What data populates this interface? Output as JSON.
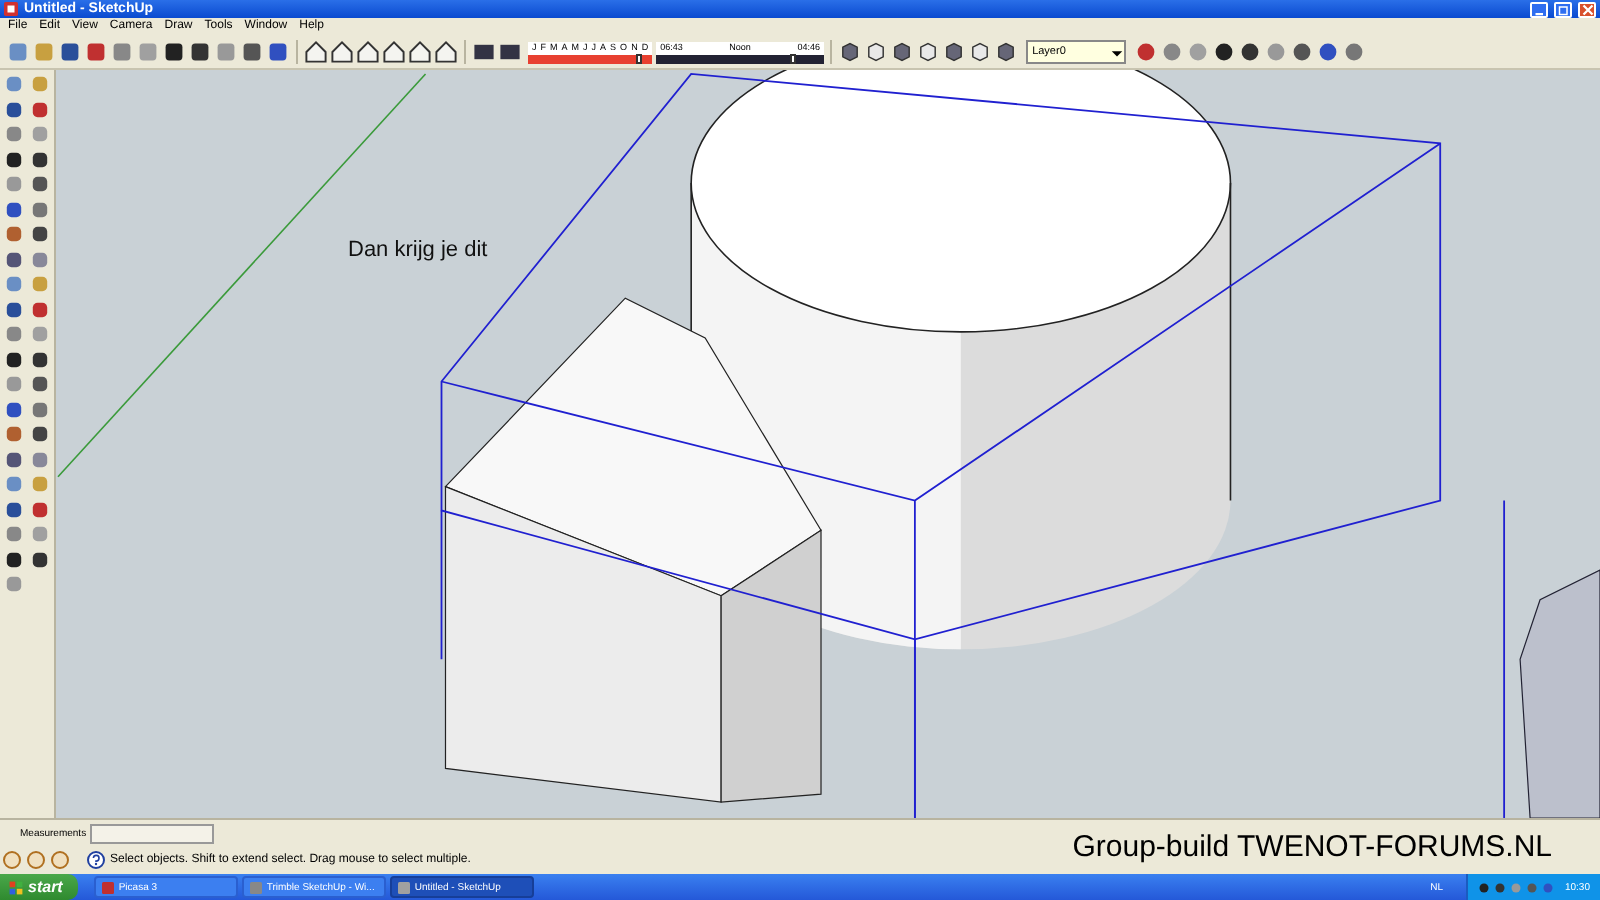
{
  "window": {
    "title": "Untitled - SketchUp"
  },
  "menu": [
    "File",
    "Edit",
    "View",
    "Camera",
    "Draw",
    "Tools",
    "Window",
    "Help"
  ],
  "shadow_bar": {
    "months": [
      "J",
      "F",
      "M",
      "A",
      "M",
      "J",
      "J",
      "A",
      "S",
      "O",
      "N",
      "D"
    ],
    "month_slider": {
      "level": 0.9
    },
    "start_time": "06:43",
    "middle": "Noon",
    "end_time": "04:46",
    "time_slider": {
      "level": 0.82
    }
  },
  "layer_select": {
    "value": "Layer0"
  },
  "canvas": {
    "note": "Dan krijg je dit"
  },
  "measurements": {
    "label": "Measurements"
  },
  "status_bar": {
    "hint": "Select objects. Shift to extend select. Drag mouse to select multiple."
  },
  "caption": "Group-build TWENOT-FORUMS.NL",
  "taskbar": {
    "start": "start",
    "tasks": [
      {
        "label": "Picasa 3",
        "selected": false
      },
      {
        "label": "Trimble SketchUp - Wi...",
        "selected": false
      },
      {
        "label": "Untitled - SketchUp",
        "selected": true
      }
    ],
    "language": "NL",
    "clock": "10:30"
  }
}
